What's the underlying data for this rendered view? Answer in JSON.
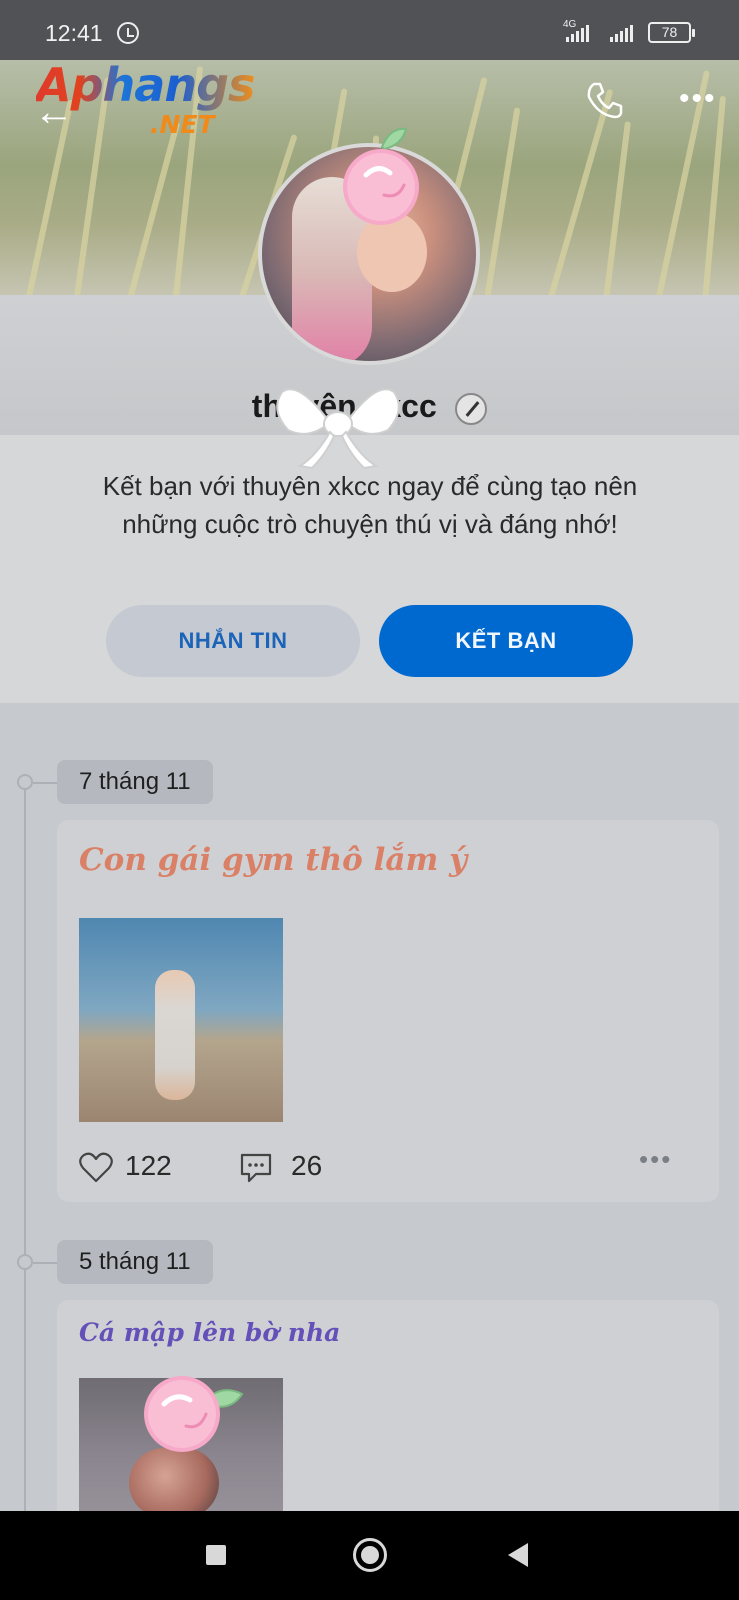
{
  "status_bar": {
    "time": "12:41",
    "network_label": "4G",
    "battery": "78"
  },
  "watermark": {
    "brand": "Aphangs",
    "domain": ".NET"
  },
  "header": {
    "back_icon": "back-arrow-icon",
    "call_icon": "phone-icon",
    "more_icon": "more-dots-icon"
  },
  "profile": {
    "name": "thuyên xkcc",
    "edit_icon": "pencil-icon",
    "intro": "Kết bạn với thuyên xkcc ngay để cùng tạo nên những cuộc trò chuyện thú vị và đáng nhớ!",
    "message_button": "NHẮN TIN",
    "add_friend_button": "KẾT BẠN"
  },
  "posts": [
    {
      "date": "7 tháng 11",
      "title": "Con gái gym thô lắm ý",
      "title_color": "#d98066",
      "likes": "122",
      "comments": "26"
    },
    {
      "date": "5 tháng 11",
      "title": "Cá mập lên bờ nha",
      "title_color": "#6450b8"
    }
  ],
  "colors": {
    "primary": "#0069cf",
    "secondary_button": "#c5cad2"
  }
}
